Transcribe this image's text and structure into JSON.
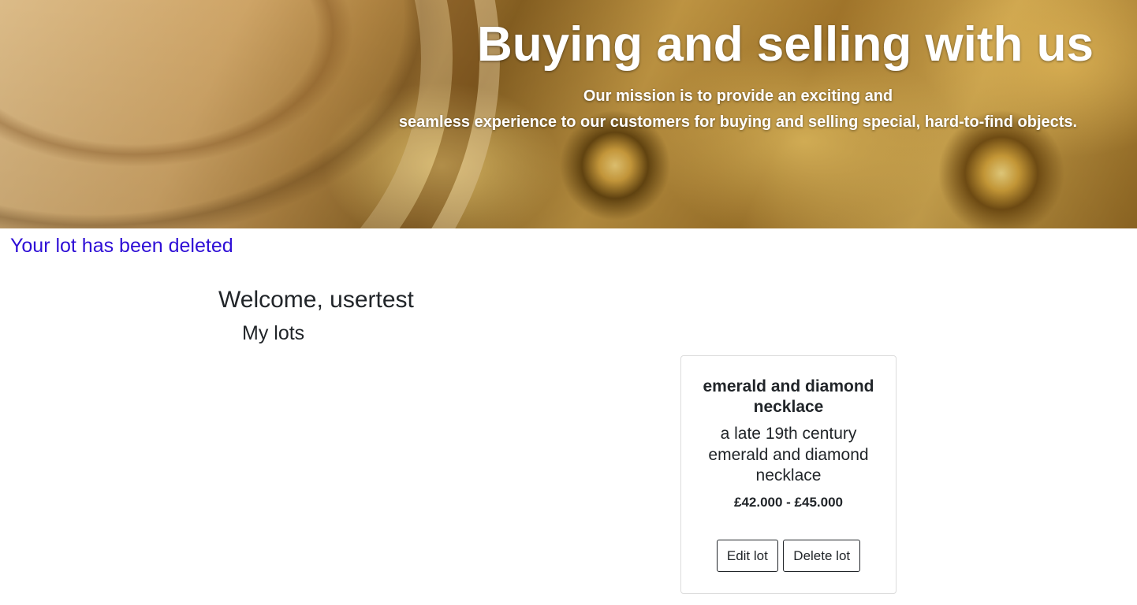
{
  "hero": {
    "title": "Buying and selling with us",
    "subtitle_line1": "Our mission is to provide an exciting and",
    "subtitle_line2": "seamless experience to our customers for buying and selling special, hard-to-find objects."
  },
  "alert": {
    "message": "Your lot has been deleted",
    "color": "#2e0ed6"
  },
  "dashboard": {
    "welcome": "Welcome, usertest",
    "section_title": "My lots"
  },
  "lots": [
    {
      "title": "emerald and diamond necklace",
      "description": "a late 19th century emerald and diamond necklace",
      "price": "£42.000 - £45.000",
      "edit_label": "Edit lot",
      "delete_label": "Delete lot"
    }
  ]
}
